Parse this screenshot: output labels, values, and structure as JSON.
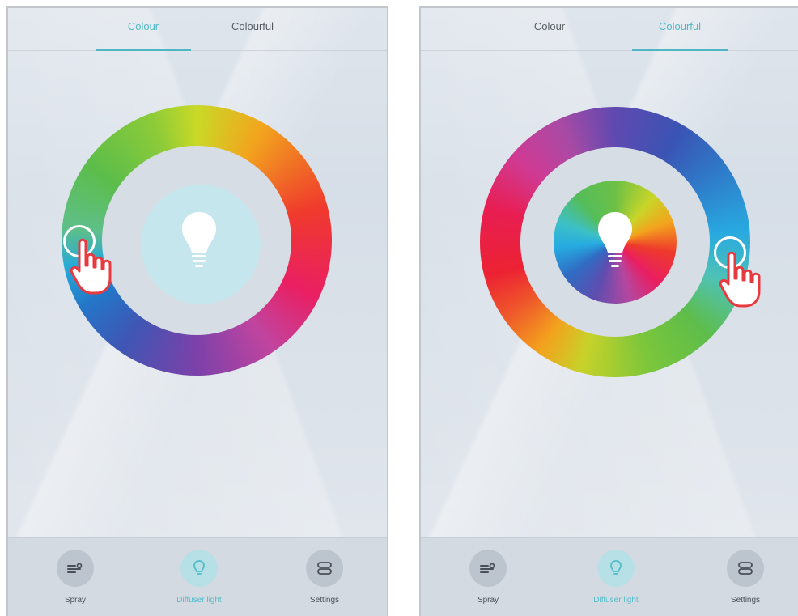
{
  "screens": [
    {
      "tabs": [
        {
          "label": "Colour",
          "active": true
        },
        {
          "label": "Colourful",
          "active": false
        }
      ],
      "nav": [
        {
          "label": "Spray",
          "icon": "spray-icon",
          "active": false
        },
        {
          "label": "Diffuser light",
          "icon": "bulb-icon",
          "active": true
        },
        {
          "label": "Settings",
          "icon": "settings-icon",
          "active": false
        }
      ]
    },
    {
      "tabs": [
        {
          "label": "Colour",
          "active": false
        },
        {
          "label": "Colourful",
          "active": true
        }
      ],
      "nav": [
        {
          "label": "Spray",
          "icon": "spray-icon",
          "active": false
        },
        {
          "label": "Diffuser light",
          "icon": "bulb-icon",
          "active": true
        },
        {
          "label": "Settings",
          "icon": "settings-icon",
          "active": false
        }
      ]
    }
  ],
  "colors": {
    "accent": "#4fb7c3",
    "accent_light": "#b7e0e6",
    "left_center_disc": "#c4e6ec",
    "hand_outline": "#e8393f"
  }
}
